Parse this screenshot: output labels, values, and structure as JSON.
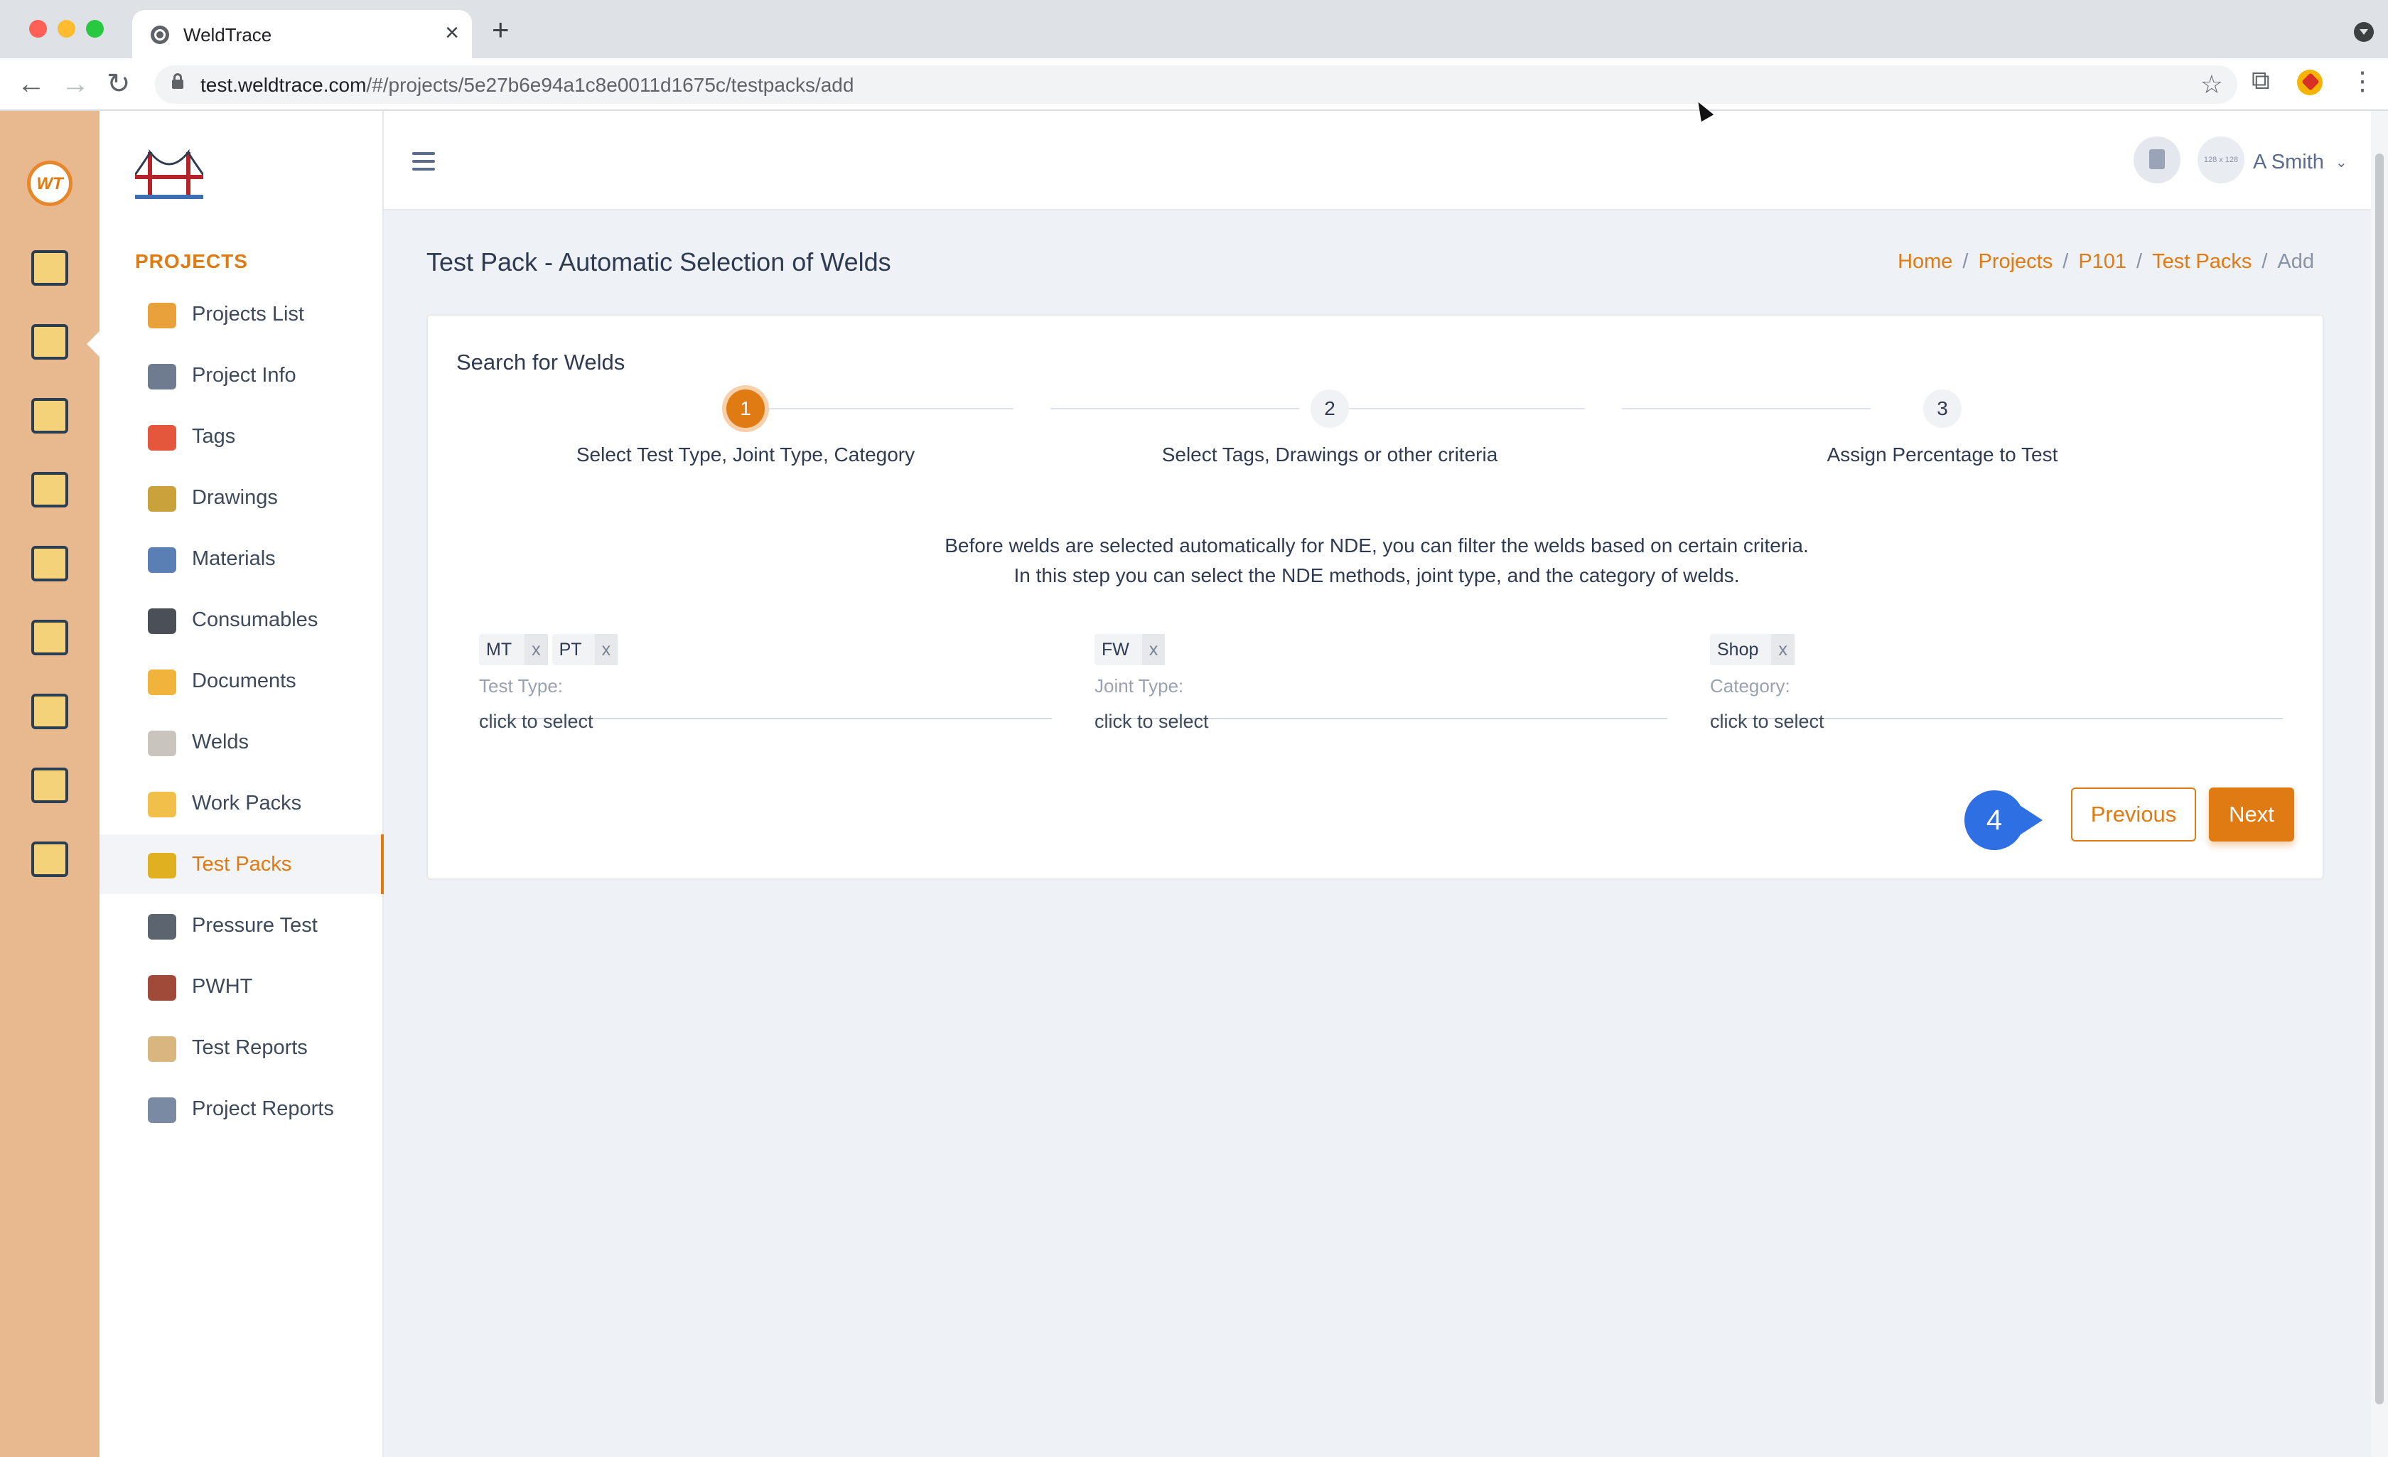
{
  "browser": {
    "tab_title": "WeldTrace",
    "url_host": "test.weldtrace.com",
    "url_path": "/#/projects/5e27b6e94a1c8e0011d1675c/testpacks/add"
  },
  "app": {
    "rail_logo_text": "WT",
    "accent_color": "#e07a12",
    "rail_color": "#e8b98e"
  },
  "sidebar": {
    "section_title": "PROJECTS",
    "items": [
      {
        "label": "Projects List",
        "icon": "projects-list-icon",
        "color": "#e9a23b"
      },
      {
        "label": "Project Info",
        "icon": "project-info-icon",
        "color": "#6f7b8e"
      },
      {
        "label": "Tags",
        "icon": "tags-icon",
        "color": "#e4573d"
      },
      {
        "label": "Drawings",
        "icon": "drawings-icon",
        "color": "#c9a23c"
      },
      {
        "label": "Materials",
        "icon": "materials-icon",
        "color": "#5a7fb5"
      },
      {
        "label": "Consumables",
        "icon": "consumables-icon",
        "color": "#4b4f57"
      },
      {
        "label": "Documents",
        "icon": "documents-icon",
        "color": "#f0b43c"
      },
      {
        "label": "Welds",
        "icon": "welds-icon",
        "color": "#c9c4bd"
      },
      {
        "label": "Work Packs",
        "icon": "work-packs-icon",
        "color": "#f0c04a"
      },
      {
        "label": "Test Packs",
        "icon": "test-packs-icon",
        "color": "#e0b020",
        "active": true
      },
      {
        "label": "Pressure Test",
        "icon": "pressure-test-icon",
        "color": "#5c6470"
      },
      {
        "label": "PWHT",
        "icon": "pwht-icon",
        "color": "#a04a3a"
      },
      {
        "label": "Test Reports",
        "icon": "test-reports-icon",
        "color": "#d9b680"
      },
      {
        "label": "Project Reports",
        "icon": "project-reports-icon",
        "color": "#7b8aa3"
      }
    ]
  },
  "header": {
    "avatar_placeholder": "128 x 128",
    "user_name": "A Smith"
  },
  "page": {
    "title": "Test Pack - Automatic Selection of Welds",
    "breadcrumb": [
      "Home",
      "Projects",
      "P101",
      "Test Packs",
      "Add"
    ]
  },
  "card": {
    "title": "Search for Welds",
    "steps": [
      {
        "number": "1",
        "label": "Select Test Type, Joint Type, Category",
        "active": true
      },
      {
        "number": "2",
        "label": "Select Tags, Drawings or other criteria",
        "active": false
      },
      {
        "number": "3",
        "label": "Assign Percentage to Test",
        "active": false
      }
    ],
    "info_line1": "Before welds are selected automatically for NDE, you can filter the welds based on certain criteria.",
    "info_line2": "In this step you can select the NDE methods, joint type, and the category of welds.",
    "fields": [
      {
        "label": "Test Type:",
        "placeholder": "click to select",
        "chips": [
          "MT",
          "PT"
        ]
      },
      {
        "label": "Joint Type:",
        "placeholder": "click to select",
        "chips": [
          "FW"
        ]
      },
      {
        "label": "Category:",
        "placeholder": "click to select",
        "chips": [
          "Shop"
        ]
      }
    ],
    "chip_remove": "x",
    "step_badge": "4",
    "previous_label": "Previous",
    "next_label": "Next"
  }
}
